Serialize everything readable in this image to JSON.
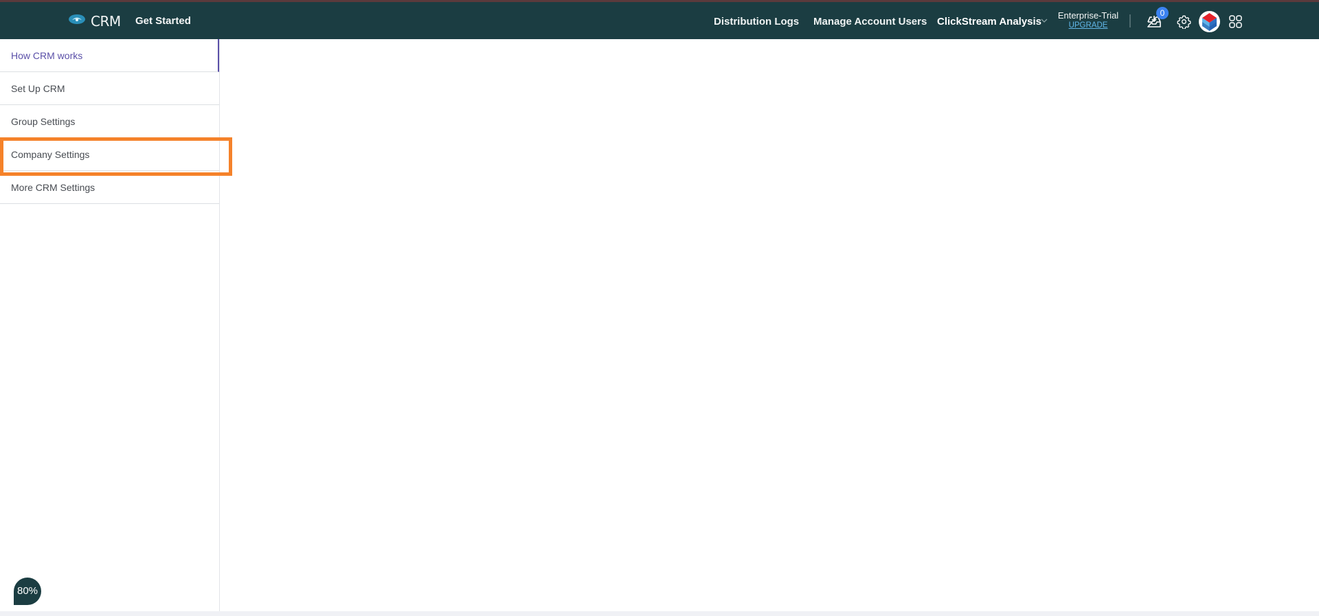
{
  "header": {
    "app_name": "CRM",
    "get_started": "Get Started",
    "nav": [
      {
        "label": "Distribution Logs"
      },
      {
        "label": "Manage Account Users"
      },
      {
        "label": "ClickStream Analysis"
      }
    ],
    "plan": {
      "name": "Enterprise-Trial",
      "upgrade_label": "UPGRADE"
    },
    "notifications_count": "0",
    "icons": [
      "logo-icon",
      "chevron-down-icon",
      "inbox-icon",
      "gear-icon",
      "avatar",
      "apps-grid-icon"
    ]
  },
  "sidebar": {
    "items": [
      {
        "label": "How CRM works",
        "active": true
      },
      {
        "label": "Set Up CRM"
      },
      {
        "label": "Group Settings"
      },
      {
        "label": "Company Settings",
        "highlighted": true
      },
      {
        "label": "More CRM Settings"
      }
    ]
  },
  "zoom_level": "80%",
  "colors": {
    "header": "#1b3d42",
    "active": "#5a4fa8",
    "highlight": "#f5822a",
    "badge": "#3b82f0"
  }
}
